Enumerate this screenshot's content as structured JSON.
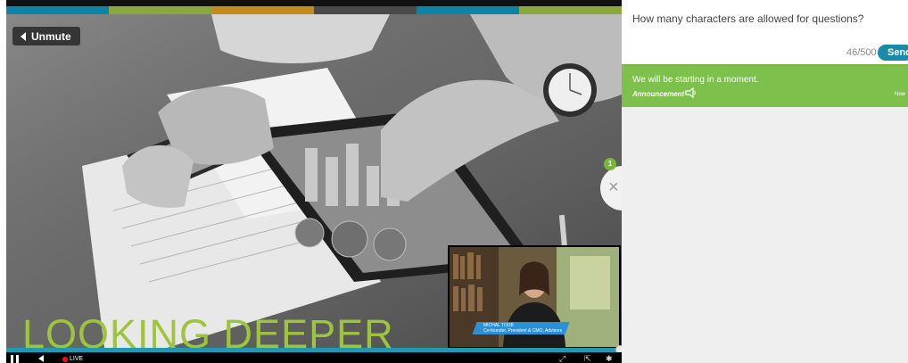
{
  "player": {
    "unmute_label": "Unmute",
    "overlay_title": "LOOKING DEEPER",
    "live_label": "LIVE",
    "pip_name": "MICHAL TOUB",
    "pip_role": "Co-founder, President & CMO, Advisors",
    "progress": 1.0,
    "color_bar": [
      "#0b84a5",
      "#8ba83a",
      "#c48a1c",
      "#4a4a4a",
      "#0b84a5",
      "#8ba83a"
    ]
  },
  "chat_toggle": {
    "badge_count": "1",
    "close_glyph": "×"
  },
  "question": {
    "text": "How many characters are allowed for questions?",
    "char_count": "46/500",
    "send_label": "Send"
  },
  "announcement": {
    "text": "We will be starting in a moment.",
    "label": "Announcement",
    "time": "Now",
    "icon": "megaphone-icon"
  },
  "colors": {
    "accent_teal": "#1a8aa8",
    "announcement_green": "#7dc04b",
    "title_green": "#9dc43b",
    "live_red": "#e11111"
  }
}
